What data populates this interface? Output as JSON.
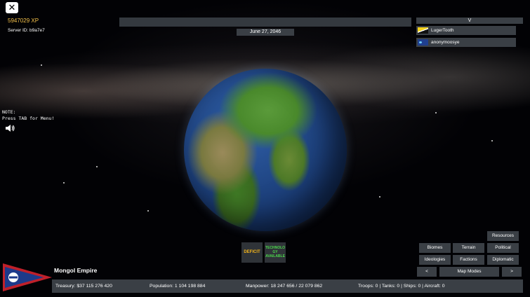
{
  "header": {
    "close_symbol": "✕",
    "xp": "5947029 XP",
    "server_id": "Server ID: b9a7e7",
    "date": "June 27, 2046"
  },
  "players": {
    "toggle": "V",
    "list": [
      {
        "name": "LugerTooth",
        "flag": "yellow-white-black-flag"
      },
      {
        "name": "anonymoosye",
        "flag": "blue-flag"
      }
    ]
  },
  "note": "NOTE:\nPress TAB for Menu!",
  "alerts": {
    "deficit": "DEFICIT",
    "technology": "TECHNOLO GY AVAILABLE"
  },
  "map_modes": {
    "resources": "Resources",
    "biomes": "Biomes",
    "terrain": "Terrain",
    "political": "Political",
    "ideologies": "Ideologies",
    "factions": "Factions",
    "diplomatic": "Diplomatic",
    "prev": "<",
    "label": "Map Modes",
    "next": ">"
  },
  "empire": {
    "name": "Mongol Empire",
    "treasury": "Treasury:  $37 115 276 420",
    "population": "Population: 1 104 198 884",
    "manpower": "Manpower:  18 247 656  /  22 079 862",
    "military": "Troops: 0  |  Tanks: 0  |  Ships: 0  |  Aircraft: 0"
  },
  "colors": {
    "panel": "#3a3f45",
    "xp": "#f3c04a",
    "deficit": "#f3b51b",
    "technology": "#4bd64b",
    "pennant_blue": "#1e3a8a",
    "pennant_red": "#c0202a"
  },
  "icons": [
    "close-icon",
    "speaker-icon",
    "flag-pennant-icon"
  ]
}
